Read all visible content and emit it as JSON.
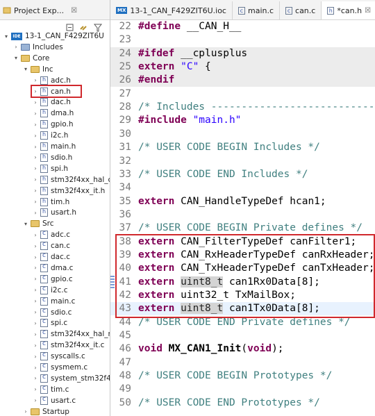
{
  "explorer": {
    "tab_label": "Project Exp...",
    "tab_close": "☒",
    "tree": [
      {
        "label": "13-1_CAN_F429ZIT6U",
        "indent": 0,
        "twisty": "▾",
        "icon": "project"
      },
      {
        "label": "Includes",
        "indent": 1,
        "twisty": "›",
        "icon": "includes"
      },
      {
        "label": "Core",
        "indent": 1,
        "twisty": "▾",
        "icon": "folder"
      },
      {
        "label": "Inc",
        "indent": 2,
        "twisty": "▾",
        "icon": "folder"
      },
      {
        "label": "adc.h",
        "indent": 3,
        "twisty": "›",
        "icon": "h"
      },
      {
        "label": "can.h",
        "indent": 3,
        "twisty": "›",
        "icon": "h"
      },
      {
        "label": "dac.h",
        "indent": 3,
        "twisty": "›",
        "icon": "h"
      },
      {
        "label": "dma.h",
        "indent": 3,
        "twisty": "›",
        "icon": "h"
      },
      {
        "label": "gpio.h",
        "indent": 3,
        "twisty": "›",
        "icon": "h"
      },
      {
        "label": "i2c.h",
        "indent": 3,
        "twisty": "›",
        "icon": "h"
      },
      {
        "label": "main.h",
        "indent": 3,
        "twisty": "›",
        "icon": "h"
      },
      {
        "label": "sdio.h",
        "indent": 3,
        "twisty": "›",
        "icon": "h"
      },
      {
        "label": "spi.h",
        "indent": 3,
        "twisty": "›",
        "icon": "h"
      },
      {
        "label": "stm32f4xx_hal_co",
        "indent": 3,
        "twisty": "›",
        "icon": "h"
      },
      {
        "label": "stm32f4xx_it.h",
        "indent": 3,
        "twisty": "›",
        "icon": "h"
      },
      {
        "label": "tim.h",
        "indent": 3,
        "twisty": "›",
        "icon": "h"
      },
      {
        "label": "usart.h",
        "indent": 3,
        "twisty": "›",
        "icon": "h"
      },
      {
        "label": "Src",
        "indent": 2,
        "twisty": "▾",
        "icon": "folder"
      },
      {
        "label": "adc.c",
        "indent": 3,
        "twisty": "›",
        "icon": "c"
      },
      {
        "label": "can.c",
        "indent": 3,
        "twisty": "›",
        "icon": "c"
      },
      {
        "label": "dac.c",
        "indent": 3,
        "twisty": "›",
        "icon": "c"
      },
      {
        "label": "dma.c",
        "indent": 3,
        "twisty": "›",
        "icon": "c"
      },
      {
        "label": "gpio.c",
        "indent": 3,
        "twisty": "›",
        "icon": "c"
      },
      {
        "label": "i2c.c",
        "indent": 3,
        "twisty": "›",
        "icon": "c"
      },
      {
        "label": "main.c",
        "indent": 3,
        "twisty": "›",
        "icon": "c"
      },
      {
        "label": "sdio.c",
        "indent": 3,
        "twisty": "›",
        "icon": "c"
      },
      {
        "label": "spi.c",
        "indent": 3,
        "twisty": "›",
        "icon": "c"
      },
      {
        "label": "stm32f4xx_hal_m",
        "indent": 3,
        "twisty": "›",
        "icon": "c"
      },
      {
        "label": "stm32f4xx_it.c",
        "indent": 3,
        "twisty": "›",
        "icon": "c"
      },
      {
        "label": "syscalls.c",
        "indent": 3,
        "twisty": "›",
        "icon": "c"
      },
      {
        "label": "sysmem.c",
        "indent": 3,
        "twisty": "›",
        "icon": "c"
      },
      {
        "label": "system_stm32f4",
        "indent": 3,
        "twisty": "›",
        "icon": "c"
      },
      {
        "label": "tim.c",
        "indent": 3,
        "twisty": "›",
        "icon": "c"
      },
      {
        "label": "usart.c",
        "indent": 3,
        "twisty": "›",
        "icon": "c"
      },
      {
        "label": "Startup",
        "indent": 2,
        "twisty": "›",
        "icon": "folder"
      }
    ]
  },
  "editor": {
    "tabs": [
      {
        "label": "13-1_CAN_F429ZIT6U.ioc",
        "badge": "MX",
        "active": false
      },
      {
        "label": "main.c",
        "badge": "c",
        "active": false
      },
      {
        "label": "can.c",
        "badge": "c",
        "active": false
      },
      {
        "label": "*can.h",
        "badge": "h",
        "active": true
      }
    ],
    "lines": [
      {
        "num": "22",
        "gray": false,
        "parts": [
          [
            "kw",
            "#define"
          ],
          [
            "ty",
            " __CAN_H__"
          ]
        ]
      },
      {
        "num": "23",
        "gray": false,
        "parts": []
      },
      {
        "num": "24",
        "gray": true,
        "parts": [
          [
            "kw",
            "#ifdef"
          ],
          [
            "ty",
            " __cplusplus"
          ]
        ]
      },
      {
        "num": "25",
        "gray": true,
        "parts": [
          [
            "kw",
            "extern"
          ],
          [
            "ty",
            " "
          ],
          [
            "st",
            "\"C\""
          ],
          [
            "ty",
            " {"
          ]
        ]
      },
      {
        "num": "26",
        "gray": true,
        "parts": [
          [
            "kw",
            "#endif"
          ]
        ]
      },
      {
        "num": "27",
        "gray": false,
        "parts": []
      },
      {
        "num": "28",
        "gray": false,
        "parts": [
          [
            "cm",
            "/* Includes ------------------------------"
          ]
        ]
      },
      {
        "num": "29",
        "gray": false,
        "parts": [
          [
            "kw",
            "#include"
          ],
          [
            "ty",
            " "
          ],
          [
            "st",
            "\"main.h\""
          ]
        ]
      },
      {
        "num": "30",
        "gray": false,
        "parts": []
      },
      {
        "num": "31",
        "gray": false,
        "parts": [
          [
            "cm",
            "/* USER CODE BEGIN Includes */"
          ]
        ]
      },
      {
        "num": "32",
        "gray": false,
        "parts": []
      },
      {
        "num": "33",
        "gray": false,
        "parts": [
          [
            "cm",
            "/* USER CODE END Includes */"
          ]
        ]
      },
      {
        "num": "34",
        "gray": false,
        "parts": []
      },
      {
        "num": "35",
        "gray": false,
        "parts": [
          [
            "kw",
            "extern"
          ],
          [
            "ty",
            " CAN_HandleTypeDef hcan1;"
          ]
        ]
      },
      {
        "num": "36",
        "gray": false,
        "parts": []
      },
      {
        "num": "37",
        "gray": false,
        "parts": [
          [
            "cm",
            "/* USER CODE BEGIN Private defines */"
          ]
        ]
      },
      {
        "num": "38",
        "gray": false,
        "parts": [
          [
            "kw",
            "extern"
          ],
          [
            "ty",
            " CAN_FilterTypeDef canFilter1;"
          ]
        ]
      },
      {
        "num": "39",
        "gray": false,
        "parts": [
          [
            "kw",
            "extern"
          ],
          [
            "ty",
            " CAN_RxHeaderTypeDef canRxHeader;"
          ]
        ]
      },
      {
        "num": "40",
        "gray": false,
        "parts": [
          [
            "kw",
            "extern"
          ],
          [
            "ty",
            " CAN_TxHeaderTypeDef canTxHeader;"
          ]
        ]
      },
      {
        "num": "41",
        "gray": false,
        "parts": [
          [
            "kw",
            "extern"
          ],
          [
            "ty",
            " "
          ],
          [
            "hl",
            "uint8_t"
          ],
          [
            "ty",
            " can1Rx0Data[8];"
          ]
        ]
      },
      {
        "num": "42",
        "gray": false,
        "parts": [
          [
            "kw",
            "extern"
          ],
          [
            "ty",
            " uint32_t TxMailBox;"
          ]
        ]
      },
      {
        "num": "43",
        "gray": false,
        "current": true,
        "parts": [
          [
            "kw",
            "extern"
          ],
          [
            "ty",
            " "
          ],
          [
            "hl",
            "uint8_t"
          ],
          [
            "ty",
            " can1Tx0Data[8];"
          ]
        ]
      },
      {
        "num": "44",
        "gray": false,
        "parts": [
          [
            "cm",
            "/* USER CODE END Private defines */"
          ]
        ]
      },
      {
        "num": "45",
        "gray": false,
        "parts": []
      },
      {
        "num": "46",
        "gray": false,
        "parts": [
          [
            "kw",
            "void"
          ],
          [
            "ty",
            " "
          ],
          [
            "kwb",
            "MX_CAN1_Init"
          ],
          [
            "ty",
            "("
          ],
          [
            "kw",
            "void"
          ],
          [
            "ty",
            ");"
          ]
        ]
      },
      {
        "num": "47",
        "gray": false,
        "parts": []
      },
      {
        "num": "48",
        "gray": false,
        "parts": [
          [
            "cm",
            "/* USER CODE BEGIN Prototypes */"
          ]
        ]
      },
      {
        "num": "49",
        "gray": false,
        "parts": []
      },
      {
        "num": "50",
        "gray": false,
        "parts": [
          [
            "cm",
            "/* USER CODE END Prototypes */"
          ]
        ]
      }
    ]
  },
  "colors": {
    "keyword": "#7f0055",
    "comment": "#3f7f7f",
    "string": "#2a00ff",
    "highlight_box": "#d0282c"
  }
}
